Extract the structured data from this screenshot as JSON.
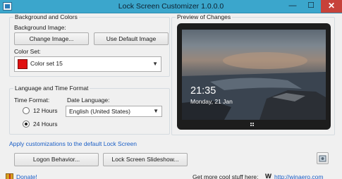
{
  "window": {
    "title": "Lock Screen Customizer 1.0.0.0",
    "minimize_glyph": "—",
    "maximize_glyph": "☐",
    "close_glyph": "✕"
  },
  "background_colors": {
    "group_title": "Background and Colors",
    "image_label": "Background Image:",
    "change_image_button": "Change Image...",
    "default_image_button": "Use Default Image",
    "color_set_label": "Color Set:",
    "color_set_value": "Color set 15",
    "color_set_swatch": "#e01010"
  },
  "language_time": {
    "group_title": "Language and Time Format",
    "time_format_label": "Time Format:",
    "option_12": "12 Hours",
    "option_24": "24 Hours",
    "selected_time_format": "24 Hours",
    "date_language_label": "Date Language:",
    "date_language_value": "English (United States)"
  },
  "preview": {
    "group_title": "Preview of Changes",
    "time": "21:35",
    "date": "Monday, 21 Jan"
  },
  "actions": {
    "apply_link": "Apply customizations to the default Lock Screen",
    "logon_behavior_button": "Logon Behavior...",
    "slideshow_button": "Lock Screen Slideshow..."
  },
  "footer": {
    "donate_link": "Donate!",
    "promo_text": "Get more cool stuff here:",
    "promo_logo": "W",
    "promo_link": "http://winaero.com"
  },
  "colors": {
    "titlebar": "#3ba6cc",
    "close_button": "#c7423a",
    "link": "#1b5fc6"
  }
}
